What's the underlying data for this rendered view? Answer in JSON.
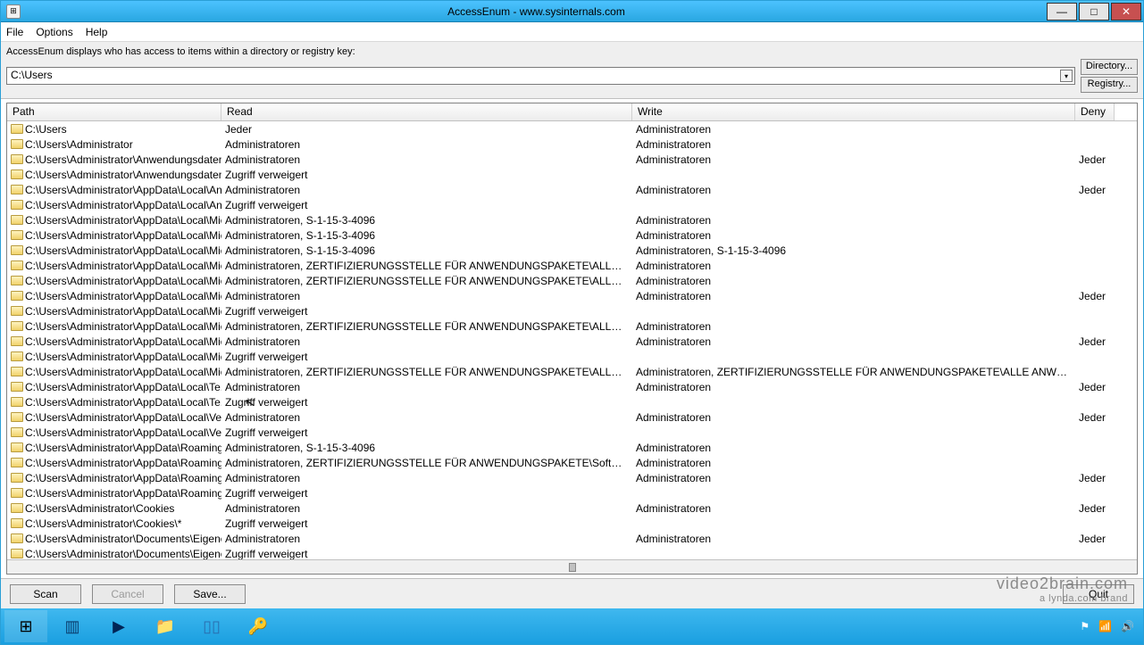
{
  "window": {
    "title": "AccessEnum - www.sysinternals.com"
  },
  "menu": {
    "file": "File",
    "options": "Options",
    "help": "Help"
  },
  "description": "AccessEnum displays who has access to items within a directory or registry key:",
  "path_value": "C:\\Users",
  "buttons": {
    "directory": "Directory...",
    "registry": "Registry...",
    "scan": "Scan",
    "cancel": "Cancel",
    "save": "Save...",
    "quit": "Quit"
  },
  "columns": {
    "path": "Path",
    "read": "Read",
    "write": "Write",
    "deny": "Deny"
  },
  "rows": [
    {
      "path": "C:\\Users",
      "read": "Jeder",
      "write": "Administratoren",
      "deny": ""
    },
    {
      "path": "C:\\Users\\Administrator",
      "read": "Administratoren",
      "write": "Administratoren",
      "deny": ""
    },
    {
      "path": "C:\\Users\\Administrator\\Anwendungsdaten",
      "read": "Administratoren",
      "write": "Administratoren",
      "deny": "Jeder"
    },
    {
      "path": "C:\\Users\\Administrator\\Anwendungsdaten\\*",
      "read": "Zugriff verweigert",
      "write": "",
      "deny": ""
    },
    {
      "path": "C:\\Users\\Administrator\\AppData\\Local\\An...",
      "read": "Administratoren",
      "write": "Administratoren",
      "deny": "Jeder"
    },
    {
      "path": "C:\\Users\\Administrator\\AppData\\Local\\An...",
      "read": "Zugriff verweigert",
      "write": "",
      "deny": ""
    },
    {
      "path": "C:\\Users\\Administrator\\AppData\\Local\\Mic...",
      "read": "Administratoren, S-1-15-3-4096",
      "write": "Administratoren",
      "deny": ""
    },
    {
      "path": "C:\\Users\\Administrator\\AppData\\Local\\Mic...",
      "read": "Administratoren, S-1-15-3-4096",
      "write": "Administratoren",
      "deny": ""
    },
    {
      "path": "C:\\Users\\Administrator\\AppData\\Local\\Mic...",
      "read": "Administratoren, S-1-15-3-4096",
      "write": "Administratoren, S-1-15-3-4096",
      "deny": ""
    },
    {
      "path": "C:\\Users\\Administrator\\AppData\\Local\\Mic...",
      "read": "Administratoren, ZERTIFIZIERUNGSSTELLE FÜR ANWENDUNGSPAKETE\\ALLE ANWEN...",
      "write": "Administratoren",
      "deny": ""
    },
    {
      "path": "C:\\Users\\Administrator\\AppData\\Local\\Mic...",
      "read": "Administratoren, ZERTIFIZIERUNGSSTELLE FÜR ANWENDUNGSPAKETE\\ALLE ANWEN...",
      "write": "Administratoren",
      "deny": ""
    },
    {
      "path": "C:\\Users\\Administrator\\AppData\\Local\\Mic...",
      "read": "Administratoren",
      "write": "Administratoren",
      "deny": "Jeder"
    },
    {
      "path": "C:\\Users\\Administrator\\AppData\\Local\\Mic...",
      "read": "Zugriff verweigert",
      "write": "",
      "deny": ""
    },
    {
      "path": "C:\\Users\\Administrator\\AppData\\Local\\Mic...",
      "read": "Administratoren, ZERTIFIZIERUNGSSTELLE FÜR ANWENDUNGSPAKETE\\ALLE ANWEN...",
      "write": "Administratoren",
      "deny": ""
    },
    {
      "path": "C:\\Users\\Administrator\\AppData\\Local\\Mic...",
      "read": "Administratoren",
      "write": "Administratoren",
      "deny": "Jeder"
    },
    {
      "path": "C:\\Users\\Administrator\\AppData\\Local\\Mic...",
      "read": "Zugriff verweigert",
      "write": "",
      "deny": ""
    },
    {
      "path": "C:\\Users\\Administrator\\AppData\\Local\\Mic...",
      "read": "Administratoren, ZERTIFIZIERUNGSSTELLE FÜR ANWENDUNGSPAKETE\\ALLE ANWEN...",
      "write": "Administratoren, ZERTIFIZIERUNGSSTELLE FÜR ANWENDUNGSPAKETE\\ALLE ANWENDUNGS...",
      "deny": ""
    },
    {
      "path": "C:\\Users\\Administrator\\AppData\\Local\\Te...",
      "read": "Administratoren",
      "write": "Administratoren",
      "deny": "Jeder"
    },
    {
      "path": "C:\\Users\\Administrator\\AppData\\Local\\Te...",
      "read": "Zugriff verweigert",
      "write": "",
      "deny": ""
    },
    {
      "path": "C:\\Users\\Administrator\\AppData\\Local\\Ver...",
      "read": "Administratoren",
      "write": "Administratoren",
      "deny": "Jeder"
    },
    {
      "path": "C:\\Users\\Administrator\\AppData\\Local\\Ver...",
      "read": "Zugriff verweigert",
      "write": "",
      "deny": ""
    },
    {
      "path": "C:\\Users\\Administrator\\AppData\\Roaming\\...",
      "read": "Administratoren, S-1-15-3-4096",
      "write": "Administratoren",
      "deny": ""
    },
    {
      "path": "C:\\Users\\Administrator\\AppData\\Roaming\\...",
      "read": "Administratoren, ZERTIFIZIERUNGSSTELLE FÜR ANWENDUNGSPAKETE\\Software- und ...",
      "write": "Administratoren",
      "deny": ""
    },
    {
      "path": "C:\\Users\\Administrator\\AppData\\Roaming\\...",
      "read": "Administratoren",
      "write": "Administratoren",
      "deny": "Jeder"
    },
    {
      "path": "C:\\Users\\Administrator\\AppData\\Roaming\\...",
      "read": "Zugriff verweigert",
      "write": "",
      "deny": ""
    },
    {
      "path": "C:\\Users\\Administrator\\Cookies",
      "read": "Administratoren",
      "write": "Administratoren",
      "deny": "Jeder"
    },
    {
      "path": "C:\\Users\\Administrator\\Cookies\\*",
      "read": "Zugriff verweigert",
      "write": "",
      "deny": ""
    },
    {
      "path": "C:\\Users\\Administrator\\Documents\\Eigene ...",
      "read": "Administratoren",
      "write": "Administratoren",
      "deny": "Jeder"
    },
    {
      "path": "C:\\Users\\Administrator\\Documents\\Eigene ...",
      "read": "Zugriff verweigert",
      "write": "",
      "deny": ""
    }
  ],
  "watermark": {
    "line1": "video2brain.com",
    "line2": "a lynda.com brand"
  },
  "taskbar_icons": [
    "start",
    "server-manager",
    "powershell",
    "explorer",
    "servers",
    "accessenum"
  ]
}
